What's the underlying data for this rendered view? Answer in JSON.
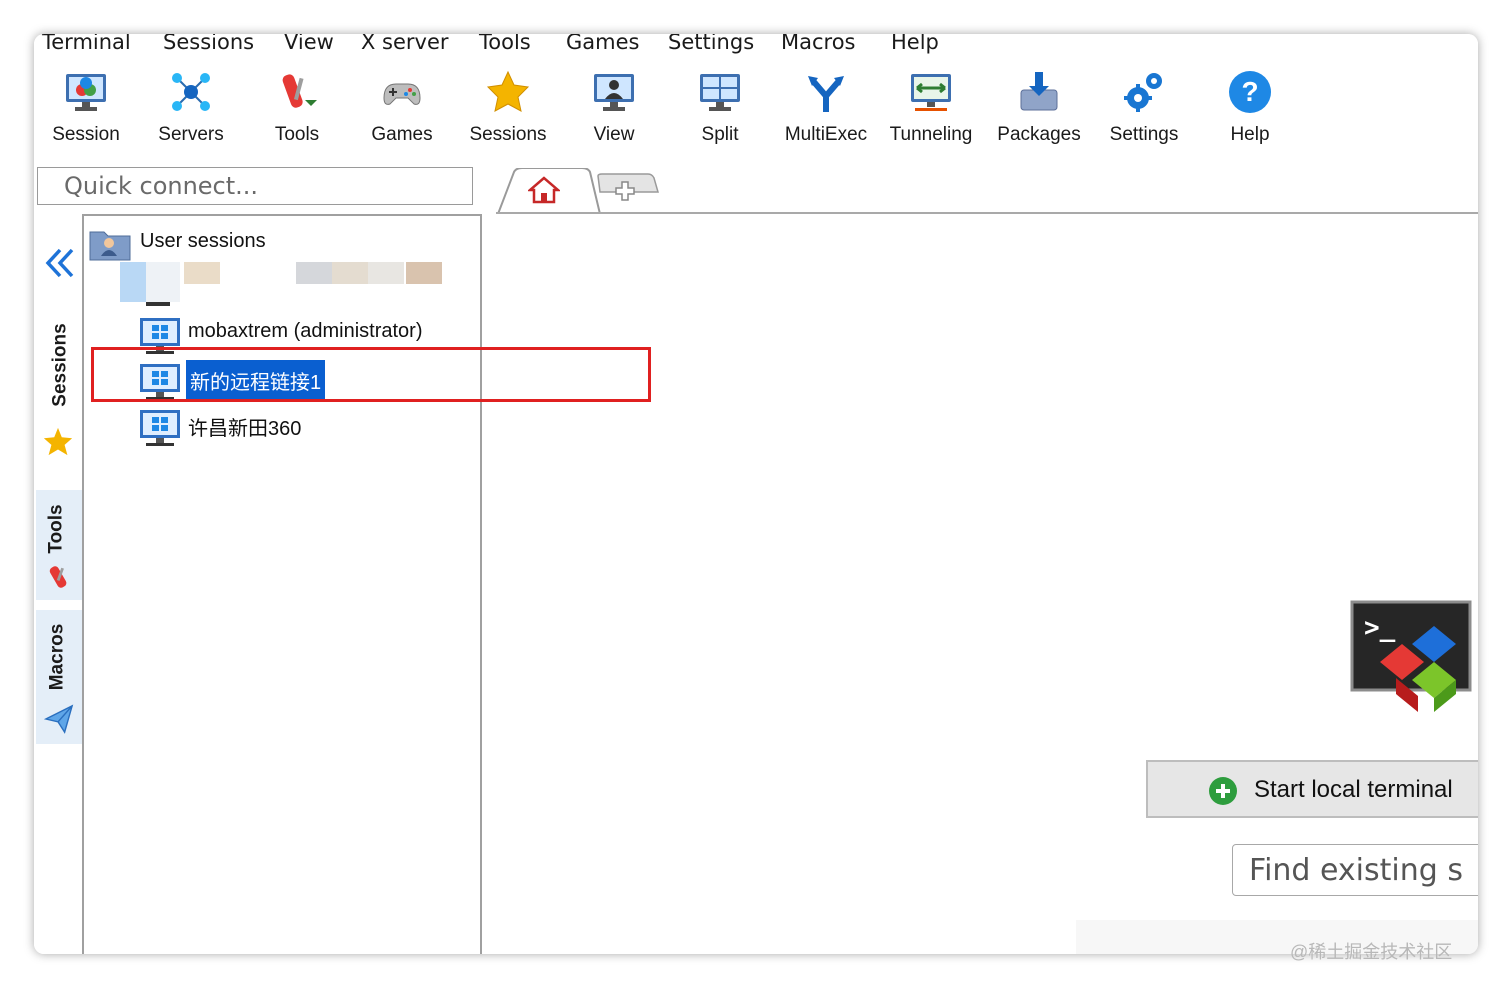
{
  "menu": [
    "Terminal",
    "Sessions",
    "View",
    "X server",
    "Tools",
    "Games",
    "Settings",
    "Macros",
    "Help"
  ],
  "toolbar": [
    "Session",
    "Servers",
    "Tools",
    "Games",
    "Sessions",
    "View",
    "Split",
    "MultiExec",
    "Tunneling",
    "Packages",
    "Settings",
    "Help"
  ],
  "quick_connect": {
    "placeholder": "Quick connect..."
  },
  "tabs": [
    {
      "icon": "home-icon"
    },
    {
      "icon": "add-tab-icon"
    }
  ],
  "side_tabs": [
    "Sessions",
    "Tools",
    "Macros"
  ],
  "tree": {
    "root_label": "User sessions",
    "items": [
      {
        "label": "mobaxtrem (administrator)",
        "selected": false
      },
      {
        "label": "新的远程链接1",
        "selected": true
      },
      {
        "label": "许昌新田360",
        "selected": false
      }
    ]
  },
  "main": {
    "start_button": "Start local terminal",
    "find_placeholder": "Find existing s"
  },
  "watermark": "@稀土掘金技术社区",
  "colors": {
    "selection": "#0a5fd0",
    "highlight_box": "#e02020",
    "side_tab_bg": "#e4eef8"
  }
}
